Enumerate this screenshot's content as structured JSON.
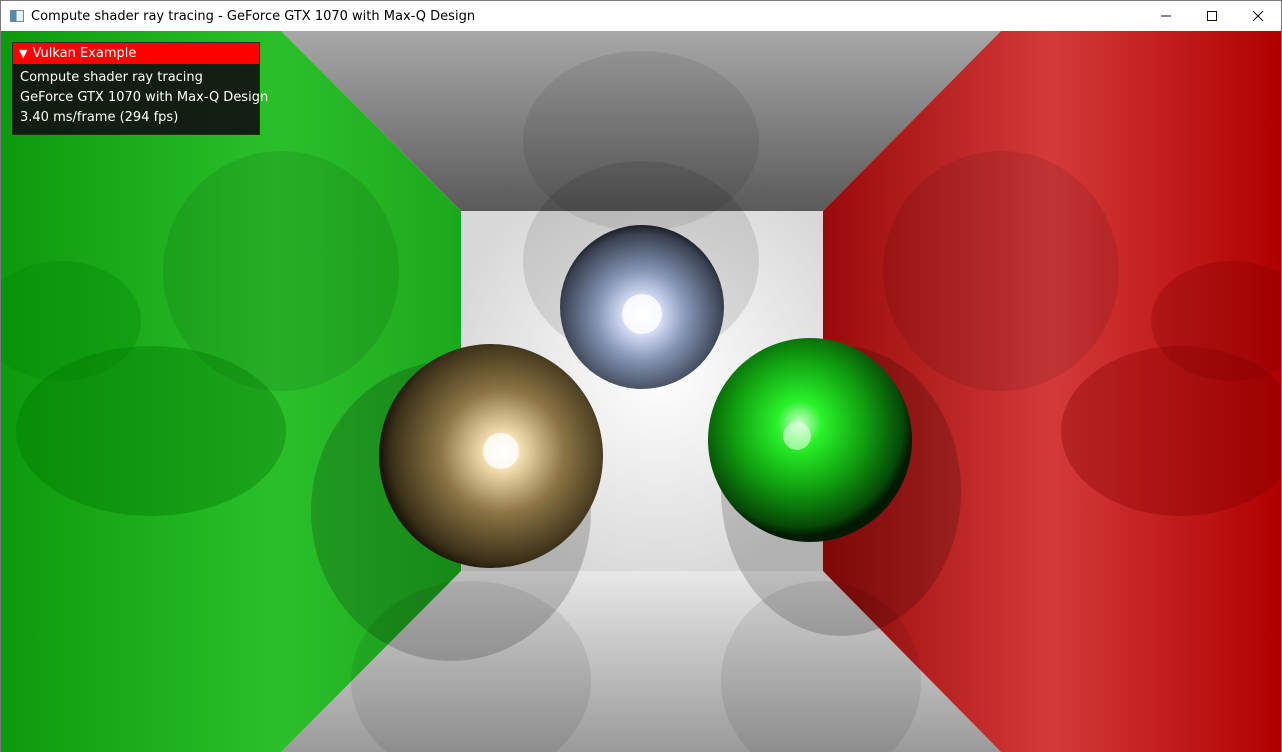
{
  "window": {
    "title": "Compute shader ray tracing - GeForce GTX 1070 with Max-Q Design",
    "controls": {
      "minimize_icon": "minimize-icon",
      "maximize_icon": "maximize-icon",
      "close_icon": "close-icon"
    }
  },
  "overlay": {
    "header": "Vulkan Example",
    "header_color": "#ff0000",
    "lines": [
      "Compute shader ray tracing",
      "GeForce GTX 1070 with Max-Q Design",
      "3.40 ms/frame (294 fps)"
    ]
  },
  "scene": {
    "left_wall_color": "#1aa81a",
    "right_wall_color": "#b30000",
    "back_wall_color": "#ffffff",
    "spheres": [
      {
        "name": "blue-sphere",
        "color": "#8aa0c0"
      },
      {
        "name": "gold-sphere",
        "color": "#c8a060"
      },
      {
        "name": "green-sphere",
        "color": "#16c016"
      }
    ]
  }
}
